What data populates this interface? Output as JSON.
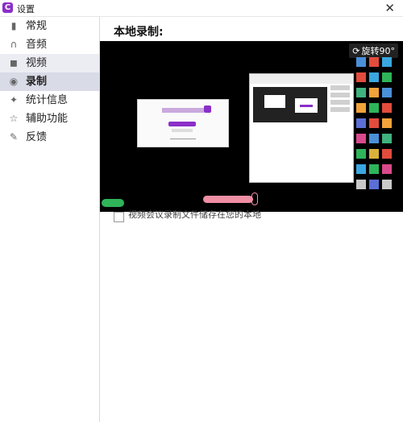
{
  "window": {
    "title": "设置",
    "app_icon_letter": "C",
    "close_glyph": "✕"
  },
  "sidebar": {
    "items": [
      {
        "label": "常规",
        "icon": "phone-icon"
      },
      {
        "label": "音频",
        "icon": "headphones-icon"
      },
      {
        "label": "视频",
        "icon": "camera-icon"
      },
      {
        "label": "录制",
        "icon": "record-icon"
      },
      {
        "label": "统计信息",
        "icon": "statistics-icon"
      },
      {
        "label": "辅助功能",
        "icon": "accessibility-icon"
      },
      {
        "label": "反馈",
        "icon": "feedback-icon"
      }
    ],
    "active_index": 3,
    "hover_index": 2
  },
  "main": {
    "section_title": "本地录制:",
    "rotate_label": "旋转90°",
    "checkbox": {
      "label": "视频会议录制文件储存在您的本地",
      "checked": false
    }
  },
  "colors": {
    "accent": "#8b2fc9",
    "sidebar_active": "#d9dbe6",
    "preview_bg": "#000000"
  }
}
